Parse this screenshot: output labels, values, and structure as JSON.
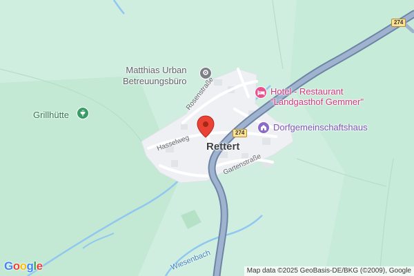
{
  "map": {
    "town_label": "Rettert",
    "route_number": "274",
    "colors": {
      "background": "#cfeee0",
      "settlement": "#eef0f3",
      "road_major": "#8ea4c2",
      "road_minor": "#ffffff",
      "water": "#8fc7f0",
      "marker": "#ea4335"
    }
  },
  "pois": {
    "betreuungsbuero": {
      "label_line1": "Matthias Urban",
      "label_line2": "Betreuungsbüro",
      "icon": "pin-icon"
    },
    "hotel": {
      "label_line1": "Hotel - Restaurant",
      "label_line2": "\"Landgasthof Gemmer\"",
      "icon": "bed-icon"
    },
    "dorfgemeinschaftshaus": {
      "label": "Dorfgemeinschaftshaus",
      "icon": "community-hall-icon"
    },
    "grillhuette": {
      "label": "Grillhütte",
      "icon": "bbq-icon"
    }
  },
  "streets": {
    "rosenstrasse": "Rosenstraße",
    "hasselweg": "Hasselweg",
    "gartenstrasse": "Gartenstraße",
    "wiesenbach": "Wiesenbach"
  },
  "footer": {
    "google_letters": [
      "G",
      "o",
      "o",
      "g",
      "l",
      "e"
    ],
    "google_colors": [
      "#4285f4",
      "#ea4335",
      "#fbbc05",
      "#4285f4",
      "#34a853",
      "#ea4335"
    ],
    "attribution": "Map data ©2025 GeoBasis-DE/BKG (©2009), Google"
  }
}
